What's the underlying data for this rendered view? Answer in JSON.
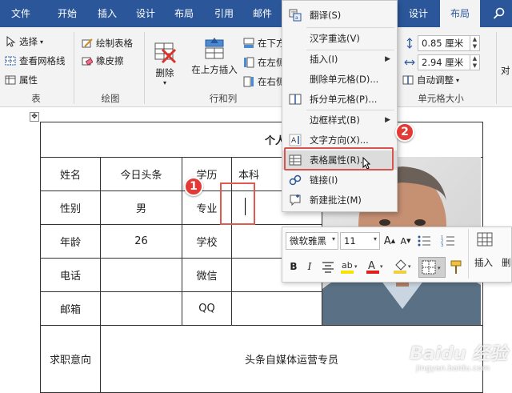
{
  "tabs": [
    "文件",
    "开始",
    "插入",
    "设计",
    "布局",
    "引用",
    "邮件",
    "设计",
    "布局"
  ],
  "active_tab_index": 8,
  "ribbon": {
    "select": "选择",
    "view_gridlines": "查看网格线",
    "properties": "属性",
    "draw_table": "绘制表格",
    "eraser": "橡皮擦",
    "delete": "删除",
    "insert_above": "在上方插入",
    "insert_below": "在下方",
    "insert_left": "在左侧",
    "insert_right": "在右侧",
    "height_value": "0.85 厘米",
    "width_value": "2.94 厘米",
    "autofit": "自动调整",
    "align": "对",
    "groups": {
      "table": "表",
      "draw": "绘图",
      "rows_cols": "行和列",
      "cell_size": "单元格大小"
    }
  },
  "context_menu": {
    "items": [
      {
        "label": "翻译(S)",
        "icon": "translate-icon",
        "arrow": false
      },
      {
        "label": "汉字重选(V)",
        "icon": "",
        "arrow": false
      },
      {
        "label": "插入(I)",
        "icon": "",
        "arrow": true
      },
      {
        "label": "删除单元格(D)...",
        "icon": "",
        "arrow": false
      },
      {
        "label": "拆分单元格(P)...",
        "icon": "split-cells-icon",
        "arrow": false
      },
      {
        "label": "边框样式(B)",
        "icon": "",
        "arrow": true
      },
      {
        "label": "文字方向(X)...",
        "icon": "text-direction-icon",
        "arrow": false
      },
      {
        "label": "表格属性(R)...",
        "icon": "table-properties-icon",
        "arrow": false
      },
      {
        "label": "链接(I)",
        "icon": "link-icon",
        "arrow": false
      },
      {
        "label": "新建批注(M)",
        "icon": "comment-icon",
        "arrow": false
      }
    ]
  },
  "table": {
    "title": "个人简历",
    "rows": [
      [
        "姓名",
        "今日头条",
        "学历",
        "本科"
      ],
      [
        "性别",
        "男",
        "专业",
        ""
      ],
      [
        "年龄",
        "26",
        "学校",
        ""
      ],
      [
        "电话",
        "",
        "微信",
        ""
      ],
      [
        "邮箱",
        "",
        "QQ",
        ""
      ]
    ],
    "job_label": "求职意向",
    "job_value": "头条自媒体运营专员"
  },
  "minitoolbar": {
    "font_name": "微软雅黑",
    "font_size": "11",
    "bold": "B",
    "italic": "I",
    "insert_label": "插入",
    "delete_label": "删"
  },
  "badges": [
    "1",
    "2"
  ],
  "watermark": {
    "text": "Baidu 经验",
    "url": "jingyan.baidu.com"
  },
  "colors": {
    "title_bar": "#2b579a",
    "badge": "#e53935",
    "highlight_border": "#d9534f"
  }
}
